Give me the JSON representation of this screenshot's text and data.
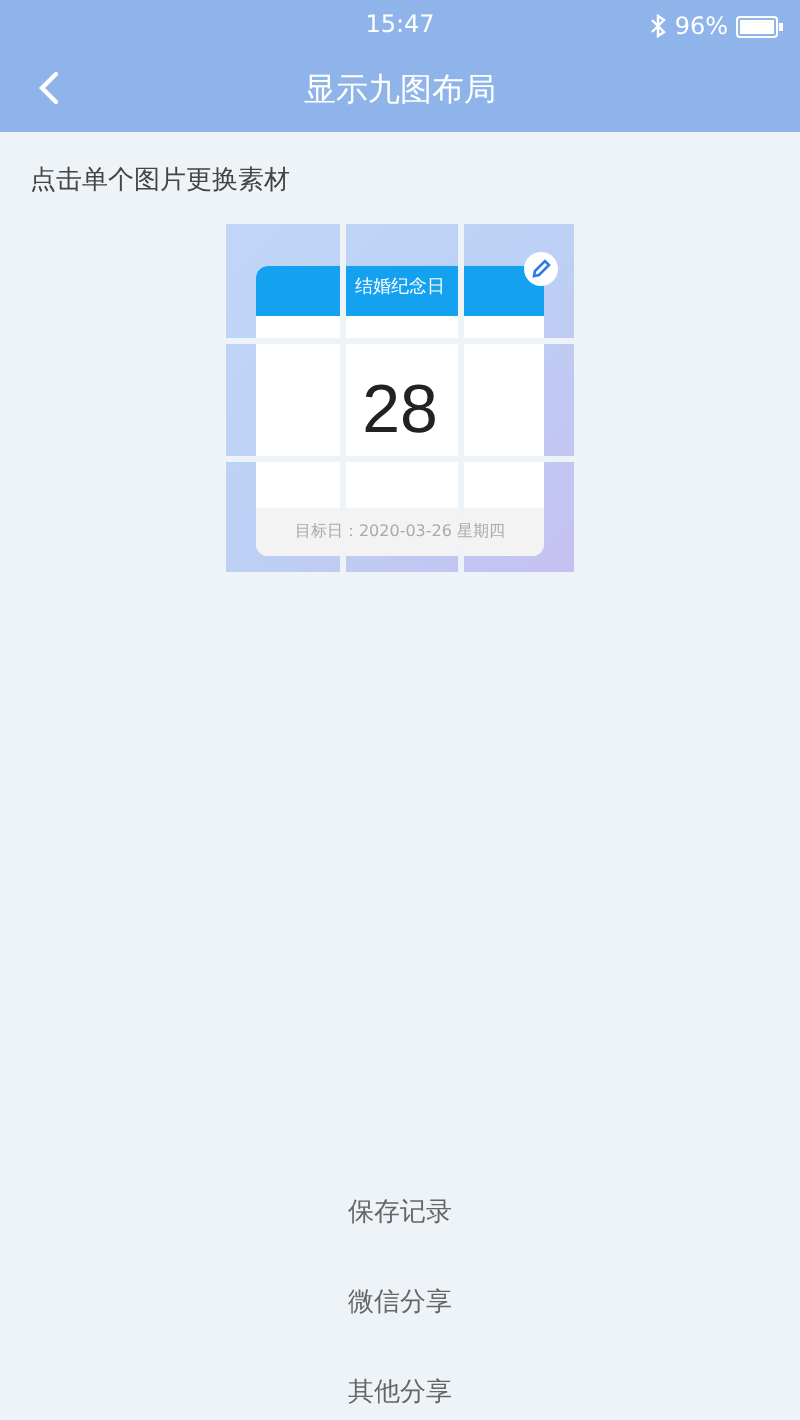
{
  "status_bar": {
    "time": "15:47",
    "battery": "96%"
  },
  "nav": {
    "title": "显示九图布局"
  },
  "hint": "点击单个图片更换素材",
  "preview": {
    "card_title": "结婚纪念日",
    "days": "28",
    "target_date": "目标日：2020-03-26 星期四"
  },
  "actions": [
    {
      "label": "保存记录"
    },
    {
      "label": "微信分享"
    },
    {
      "label": "其他分享"
    }
  ]
}
